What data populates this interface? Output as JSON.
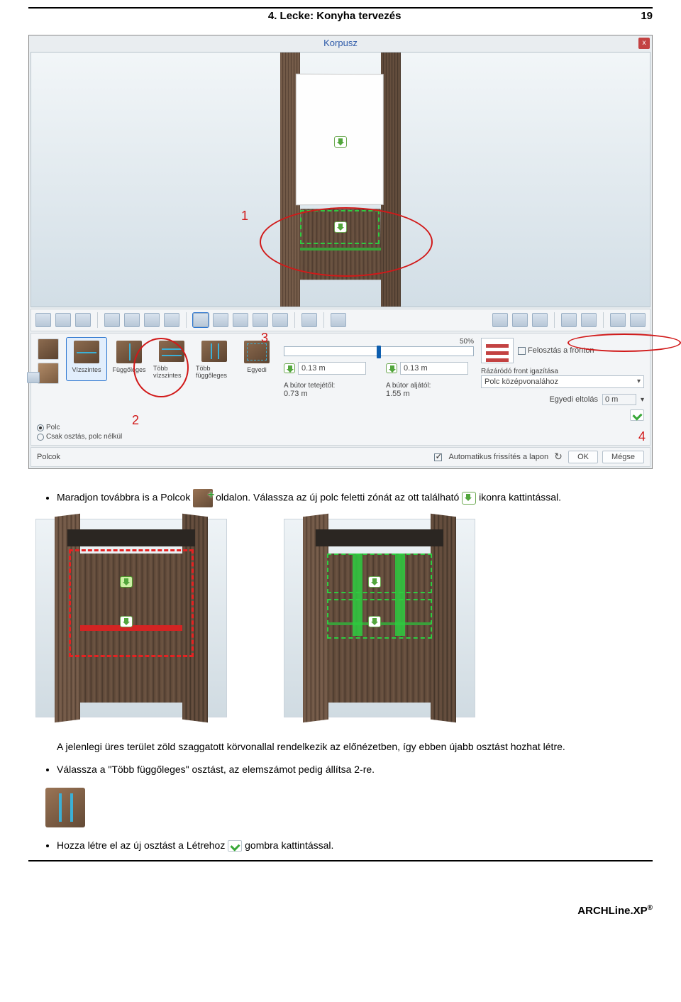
{
  "header": {
    "title": "4. Lecke: Konyha tervezés",
    "page": "19"
  },
  "dialog": {
    "title": "Korpusz",
    "close_x": "x",
    "markers": {
      "m1": "1",
      "m2": "2",
      "m3": "3",
      "m4": "4"
    },
    "thumbs": {
      "horizontal": "Vízszintes",
      "vertical": "Függőleges",
      "multi_h": "Több vízszintes",
      "multi_v": "Több függőleges",
      "custom": "Egyedi"
    },
    "radios": {
      "polc": "Polc",
      "csak_osztas": "Csak osztás, polc nélkül"
    },
    "slider_label": "50%",
    "dims": {
      "left": "0.13 m",
      "right": "0.13 m",
      "top_label": "A bútor tetejétől:",
      "top_val": "0.73 m",
      "bottom_label": "A bútor aljától:",
      "bottom_val": "1.55 m"
    },
    "right": {
      "felosztas": "Felosztás a fronton",
      "razarodo": "Rázáródó front igazítása",
      "polc_kozep": "Polc középvonalához",
      "eltolas_label": "Egyedi eltolás",
      "eltolas_val": "0 m"
    },
    "footer": {
      "left_label": "Polcok",
      "auto": "Automatikus frissítés a lapon",
      "ok": "OK",
      "cancel": "Mégse"
    }
  },
  "text": {
    "b1_a": "Maradjon továbbra is a Polcok ",
    "b1_b": " oldalon. Válassza az új polc feletti zónát az ott található ",
    "b1_c": " ikonra kattintással.",
    "para": "A jelenlegi üres terület zöld szaggatott körvonallal rendelkezik az előnézetben, így ebben újabb osztást hozhat létre.",
    "b2": "Válassza a \"Több függőleges\" osztást, az elemszámot pedig állítsa 2-re.",
    "b3_a": "Hozza létre el az új osztást a Létrehoz ",
    "b3_b": " gombra kattintással."
  },
  "brand": "ARCHLine.XP",
  "brand_r": "®"
}
